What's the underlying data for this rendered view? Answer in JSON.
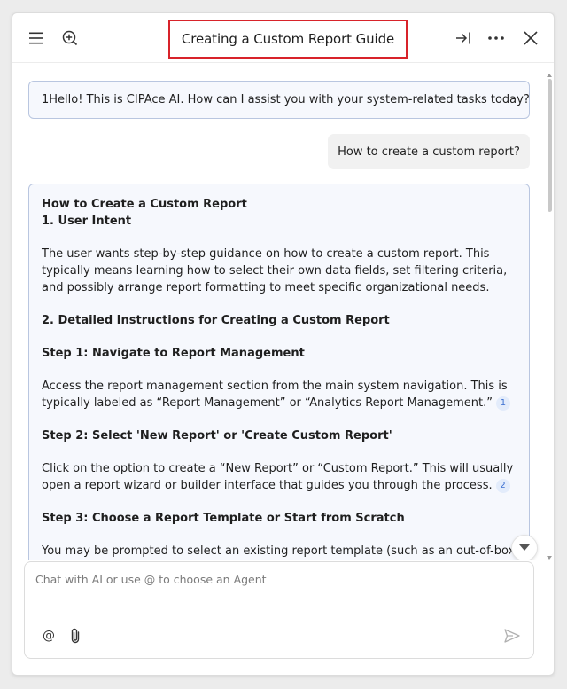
{
  "header": {
    "title": "Creating a Custom Report Guide",
    "icons": [
      "menu-icon",
      "new-chat-icon",
      "dock-right-icon",
      "more-icon",
      "close-icon"
    ]
  },
  "chat": {
    "greeting": "1Hello! This is CIPAce AI. How can I assist you with your system-related tasks today?",
    "user_message": "How to create a custom report?",
    "answer": {
      "heading": "How to Create a Custom Report",
      "section1_title": "1. User Intent",
      "section1_text": "The user wants step-by-step guidance on how to create a custom report. This typically means learning how to select their own data fields, set filtering criteria, and possibly arrange report formatting to meet specific organizational needs.",
      "section2_title": "2. Detailed Instructions for Creating a Custom Report",
      "step1_title": "Step 1: Navigate to Report Management",
      "step1_text": "Access the report management section from the main system navigation. This is typically labeled as “Report Management” or “Analytics Report Management.”",
      "step1_cite": "1",
      "step2_title": "Step 2: Select 'New Report' or 'Create Custom Report'",
      "step2_text": "Click on the option to create a “New Report” or “Custom Report.” This will usually open a report wizard or builder interface that guides you through the process.",
      "step2_cite": "2",
      "step3_title": "Step 3: Choose a Report Template or Start from Scratch",
      "step3_text": "You may be prompted to select an existing report template (such as an out-of-box"
    }
  },
  "composer": {
    "placeholder": "Chat with AI or use @ to choose an Agent",
    "at_label": "@"
  },
  "colors": {
    "title_border": "#d8232a",
    "bubble_border": "#b9c6e0",
    "bubble_bg": "#f6f8fd",
    "cite_color": "#3b6fd1"
  }
}
